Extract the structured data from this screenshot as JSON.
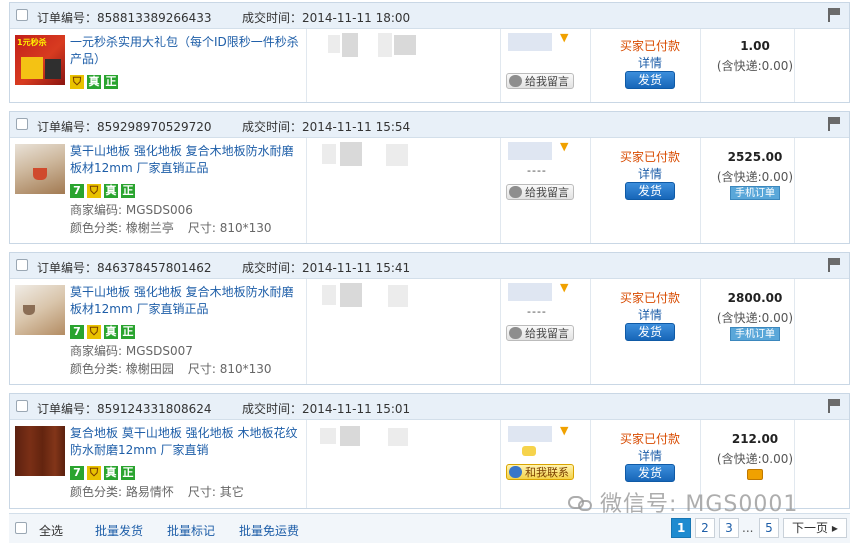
{
  "labels": {
    "order_no": "订单编号：",
    "deal_time": "成交时间：",
    "merchant_code": "商家编码: ",
    "color_class": "颜色分类: ",
    "size": "尺寸: ",
    "leave_message": "给我留言",
    "contact_me": "和我联系",
    "status_paid": "买家已付款",
    "details": "详情",
    "ship": "发货",
    "phone_order": "手机订单",
    "shipping_incl": "(含快递:0.00)",
    "dash": "----"
  },
  "tags": {
    "seven": "7",
    "shield": "⛉",
    "real": "真",
    "genuine": "正"
  },
  "orders": [
    {
      "order_no": "858813389266433",
      "time": "2014-11-11 18:00",
      "title": "一元秒杀实用大礼包（每个ID限秒一件秒杀产品）",
      "thumb_text": "1元秒杀",
      "merchant_code": "",
      "color": "",
      "size": "",
      "price": "1.00"
    },
    {
      "order_no": "859298970529720",
      "time": "2014-11-11 15:54",
      "title": "莫干山地板 强化地板 复合木地板防水耐磨板材12mm 厂家直销正品",
      "merchant_code": "MGSDS006",
      "color": "橡榭兰亭",
      "size": "810*130",
      "price": "2525.00"
    },
    {
      "order_no": "846378457801462",
      "time": "2014-11-11 15:41",
      "title": "莫干山地板 强化地板 复合木地板防水耐磨板材12mm 厂家直销正品",
      "merchant_code": "MGSDS007",
      "color": "橡榭田园",
      "size": "810*130",
      "price": "2800.00"
    },
    {
      "order_no": "859124331808624",
      "time": "2014-11-11 15:01",
      "title": "复合地板 莫干山地板 强化地板 木地板花纹防水耐磨12mm 厂家直销",
      "merchant_code": "",
      "color": "路易情怀",
      "size": "其它",
      "price": "212.00"
    }
  ],
  "footer": {
    "select_all": "全选",
    "batch_ship": "批量发货",
    "batch_mark": "批量标记",
    "batch_free": "批量免运费",
    "pages": [
      "1",
      "2",
      "3",
      "5"
    ],
    "ellipsis": "...",
    "current_page": "1",
    "next": "下一页"
  },
  "watermark": "微信号: MGS0001",
  "colors": {
    "accent_blue": "#1e5ea8",
    "status_orange": "#d84b00",
    "header_bg": "#e8f0f8"
  }
}
